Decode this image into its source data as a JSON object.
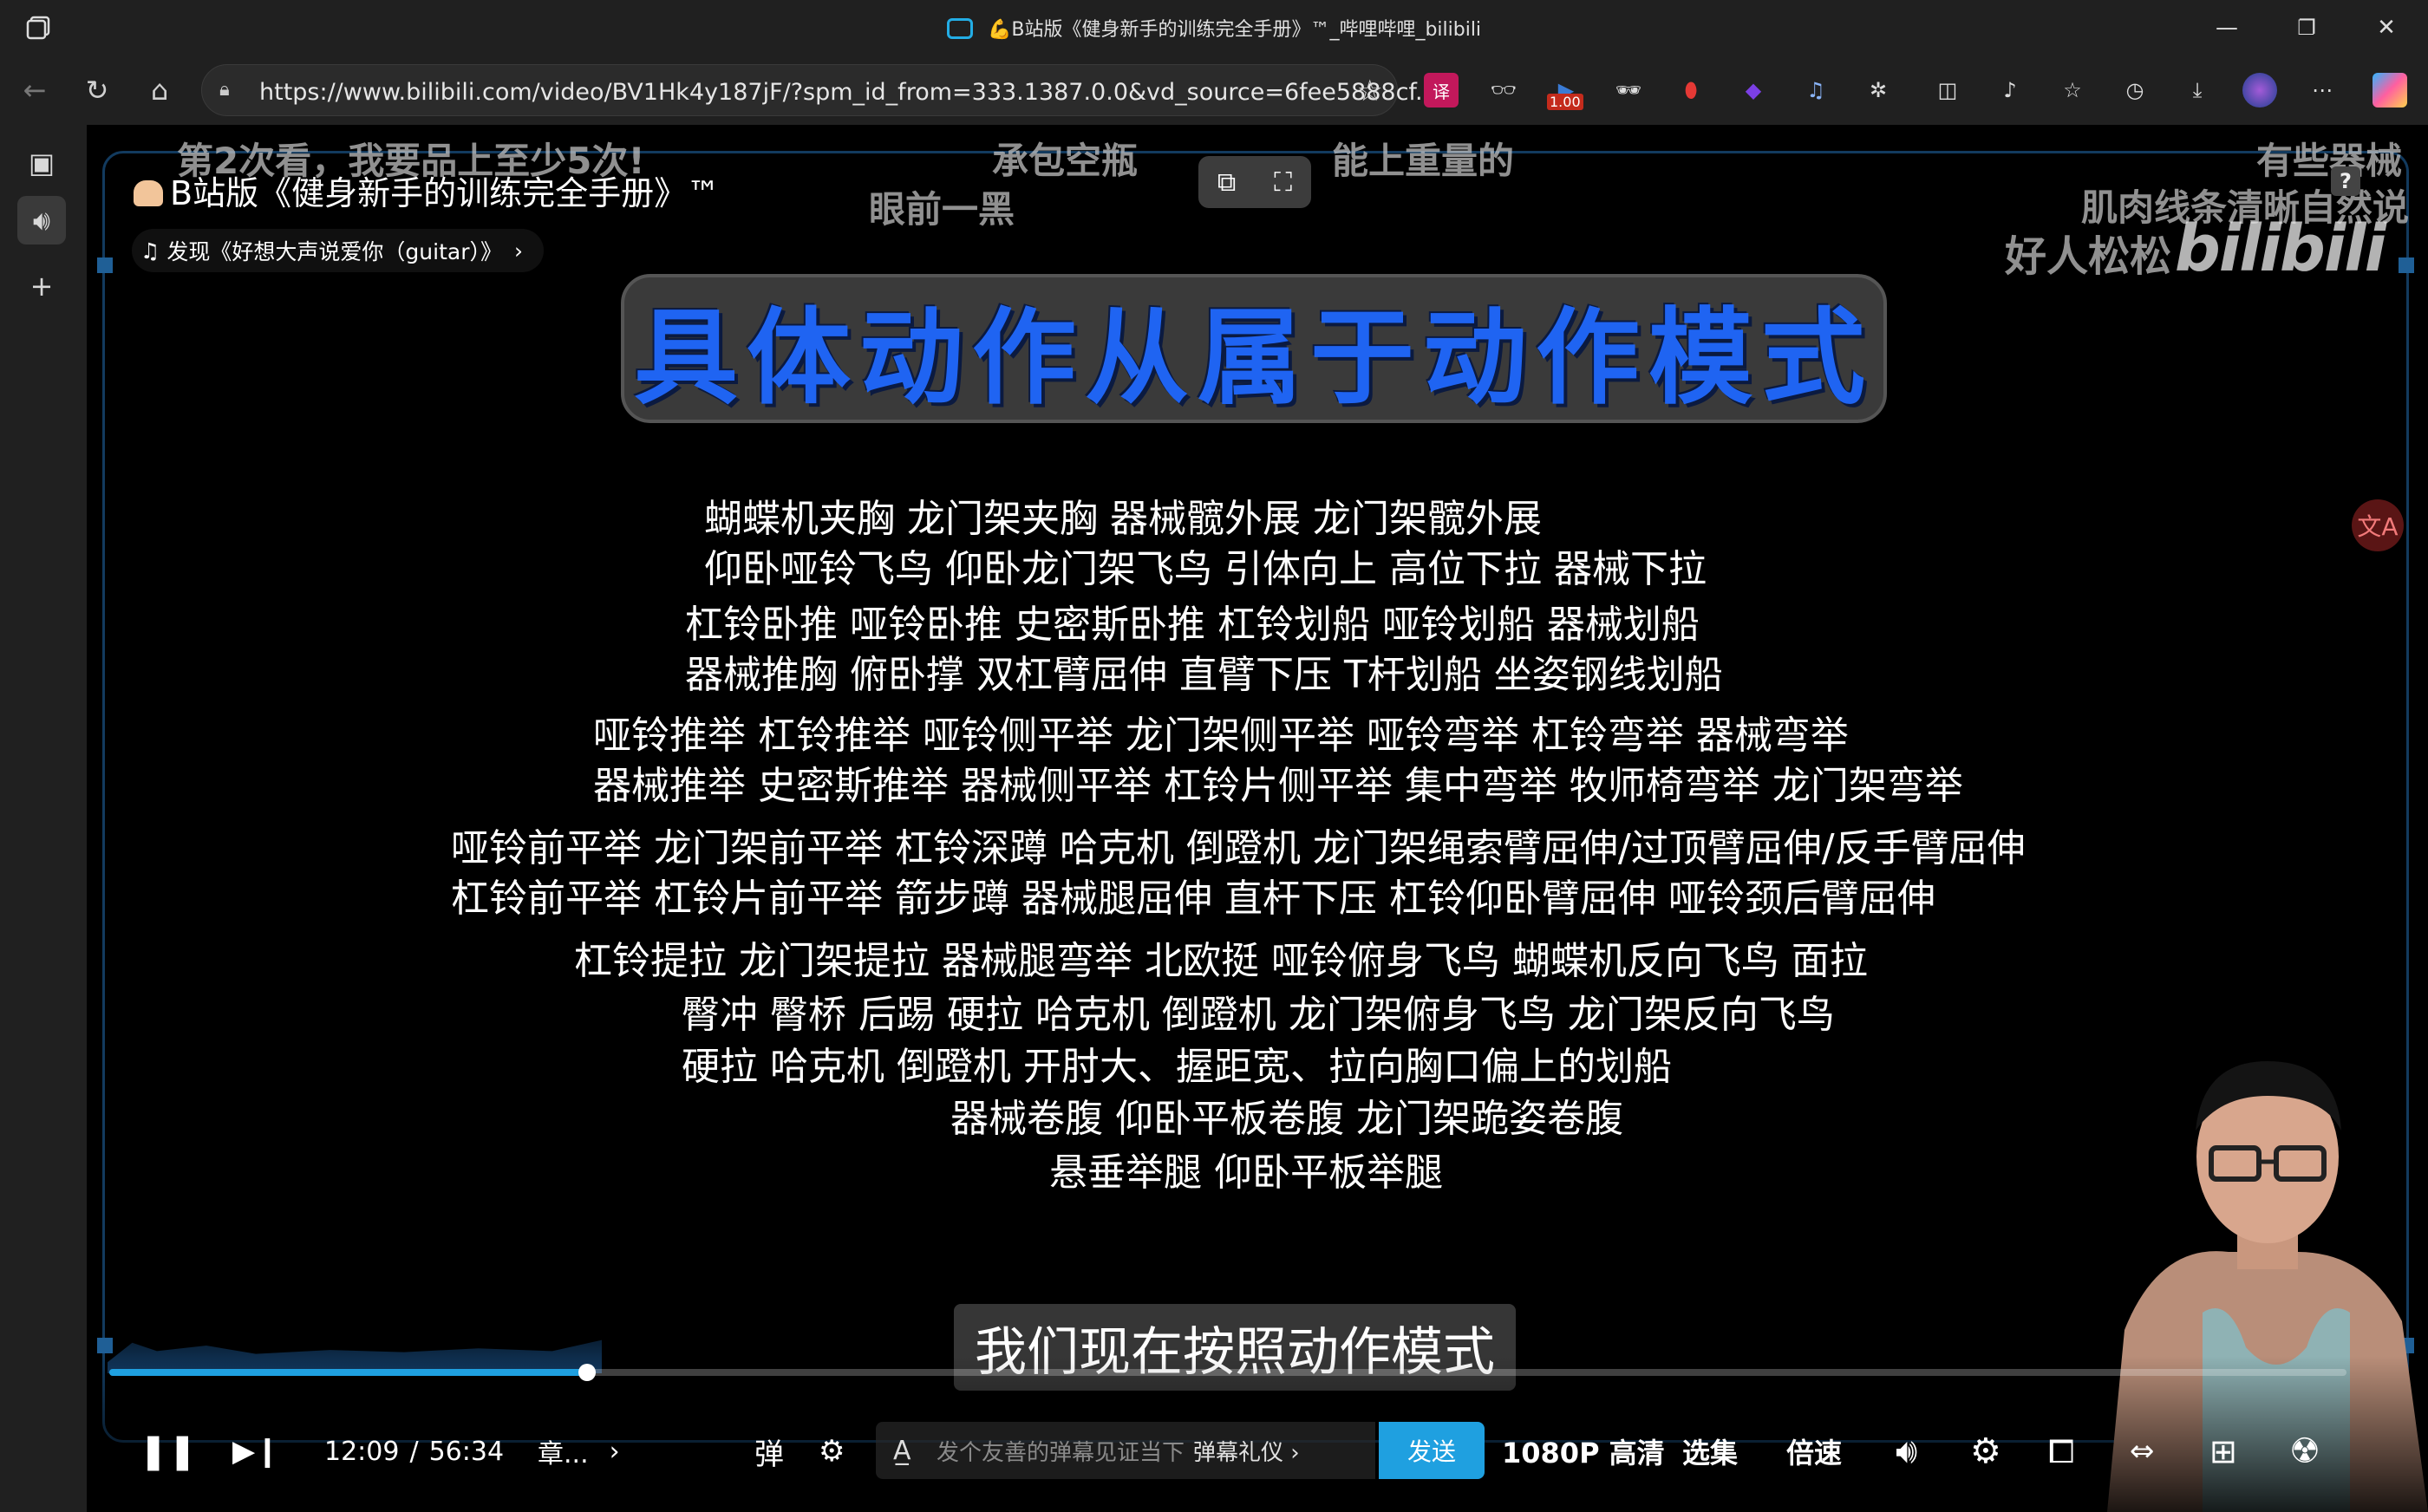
{
  "window": {
    "title": "💪B站版《健身新手的训练完全手册》™_哔哩哔哩_bilibili",
    "controls": {
      "minimize": "—",
      "restore": "❐",
      "close": "✕"
    }
  },
  "navbar": {
    "url": "https://www.bilibili.com/video/BV1Hk4y187jF/?spm_id_from=333.1387.0.0&vd_source=6fee5888cf...",
    "ext_badge": "1.00"
  },
  "video": {
    "title": "B站版《健身新手的训练完全手册》™",
    "music": "发现《好想大声说爱你（guitar）》",
    "logo": "bilibili",
    "help_badge": "?",
    "danmaku": [
      "第2次看，我要品上至少5次!",
      "眼前一黑",
      "承包空瓶",
      "能上重量的",
      "有些器械",
      "肌肉线条清晰自然说",
      "好人松松"
    ],
    "big_title": "具体动作从属于动作模式",
    "lines": [
      "蝴蝶机夹胸    龙门架夹胸    器械髋外展 龙门架髋外展",
      "仰卧哑铃飞鸟 仰卧龙门架飞鸟  引体向上 高位下拉 器械下拉",
      "杠铃卧推 哑铃卧推 史密斯卧推     杠铃划船 哑铃划船 器械划船",
      "器械推胸 俯卧撑   双杠臂屈伸      直臂下压 T杆划船  坐姿钢线划船",
      "哑铃推举 杠铃推举          哑铃侧平举 龙门架侧平举  哑铃弯举 杠铃弯举 器械弯举",
      "器械推举 史密斯推举      器械侧平举 杠铃片侧平举  集中弯举 牧师椅弯举 龙门架弯举",
      "哑铃前平举 龙门架前平举   杠铃深蹲 哈克机 倒蹬机   龙门架绳索臂屈伸/过顶臂屈伸/反手臂屈伸",
      "杠铃前平举 杠铃片前平举   箭步蹲    器械腿屈伸        直杆下压 杠铃仰卧臂屈伸 哑铃颈后臂屈伸",
      "杠铃提拉 龙门架提拉      器械腿弯举 北欧挺   哑铃俯身飞鸟 蝴蝶机反向飞鸟 面拉",
      "臀冲 臀桥 后踢    硬拉 哈克机 倒蹬机    龙门架俯身飞鸟 龙门架反向飞鸟",
      "硬拉 哈克机 倒蹬机   开肘大、握距宽、拉向胸口偏上的划船",
      "器械卷腹 仰卧平板卷腹 龙门架跪姿卷腹",
      "悬垂举腿 仰卧平板举腿"
    ],
    "subtitle": "我们现在按照动作模式"
  },
  "controls": {
    "current_time": "12:09",
    "separator": "/",
    "duration": "56:34",
    "chapter": "章...",
    "danmaku_placeholder": "发个友善的弹幕见证当下",
    "danmaku_gift": "弹幕礼仪 ›",
    "send": "发送",
    "quality": "1080P 高清",
    "episodes": "选集",
    "speed": "倍速",
    "progress": 0.2137
  },
  "colors": {
    "accent": "#1fa0e0",
    "title_blue": "#1f64f2"
  }
}
